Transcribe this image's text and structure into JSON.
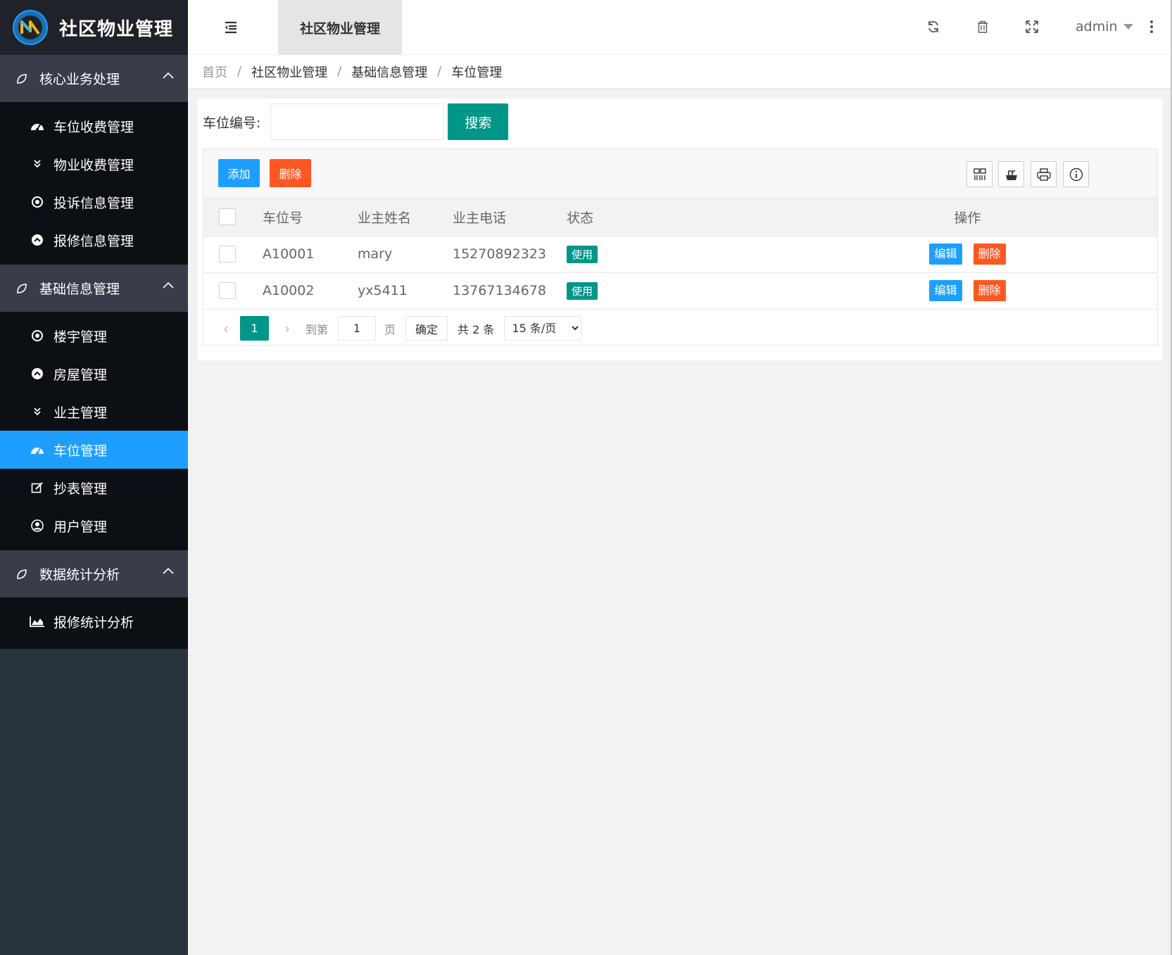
{
  "app": {
    "title": "社区物业管理"
  },
  "header": {
    "tab": "社区物业管理",
    "user": "admin"
  },
  "sidebar": {
    "groups": [
      {
        "label": "核心业务处理",
        "items": [
          {
            "label": "车位收费管理",
            "icon": "dashboard-icon"
          },
          {
            "label": "物业收费管理",
            "icon": "double-chevron-down-icon"
          },
          {
            "label": "投诉信息管理",
            "icon": "target-icon"
          },
          {
            "label": "报修信息管理",
            "icon": "circle-up-icon"
          }
        ]
      },
      {
        "label": "基础信息管理",
        "items": [
          {
            "label": "楼宇管理",
            "icon": "target-icon"
          },
          {
            "label": "房屋管理",
            "icon": "circle-up-icon"
          },
          {
            "label": "业主管理",
            "icon": "double-chevron-down-icon"
          },
          {
            "label": "车位管理",
            "icon": "dashboard-icon",
            "active": true
          },
          {
            "label": "抄表管理",
            "icon": "edit-icon"
          },
          {
            "label": "用户管理",
            "icon": "user-circle-icon"
          }
        ]
      },
      {
        "label": "数据统计分析",
        "items": [
          {
            "label": "报修统计分析",
            "icon": "area-chart-icon"
          }
        ]
      }
    ]
  },
  "breadcrumb": [
    "首页",
    "社区物业管理",
    "基础信息管理",
    "车位管理"
  ],
  "search": {
    "label": "车位编号:",
    "value": "",
    "button": "搜索"
  },
  "toolbar": {
    "add": "添加",
    "delete": "删除"
  },
  "table": {
    "columns": [
      "车位号",
      "业主姓名",
      "业主电话",
      "状态",
      "操作"
    ],
    "rows": [
      {
        "spot": "A10001",
        "owner": "mary",
        "phone": "15270892323",
        "status": "使用",
        "edit": "编辑",
        "delete": "删除"
      },
      {
        "spot": "A10002",
        "owner": "yx5411",
        "phone": "13767134678",
        "status": "使用",
        "edit": "编辑",
        "delete": "删除"
      }
    ]
  },
  "pager": {
    "current": "1",
    "goto_label": "到第",
    "goto_value": "1",
    "page_label": "页",
    "confirm": "确定",
    "total": "共 2 条",
    "per_page": "15 条/页"
  },
  "colors": {
    "sidebar": "#28333e",
    "active": "#1e9fff",
    "primary": "#009688",
    "danger": "#ff5722"
  }
}
